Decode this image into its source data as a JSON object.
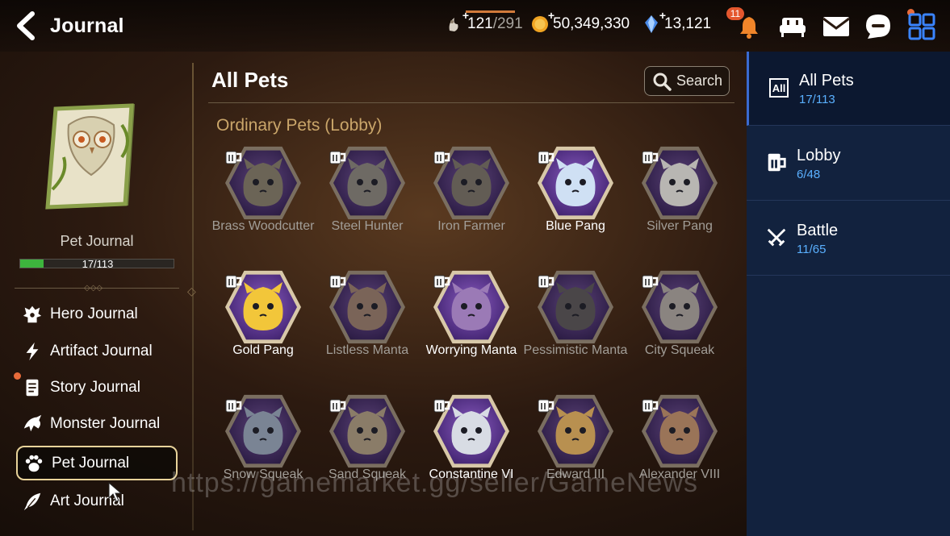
{
  "header": {
    "title": "Journal",
    "stamina": "121",
    "stamina_max": "/291",
    "gold": "50,349,330",
    "crystals": "13,121",
    "notification_count": "11"
  },
  "left_panel": {
    "journal_label": "Pet Journal",
    "progress_text": "17/113",
    "progress_fraction": 0.15,
    "menu": [
      {
        "label": "Hero Journal",
        "icon": "hero-icon"
      },
      {
        "label": "Artifact Journal",
        "icon": "lightning-icon"
      },
      {
        "label": "Story Journal",
        "icon": "scroll-icon"
      },
      {
        "label": "Monster Journal",
        "icon": "dragon-icon"
      },
      {
        "label": "Pet Journal",
        "icon": "paw-icon"
      },
      {
        "label": "Art Journal",
        "icon": "quill-icon"
      }
    ]
  },
  "main": {
    "section_title": "All Pets",
    "search_label": "Search",
    "subsection_title": "Ordinary Pets (Lobby)",
    "pets": [
      {
        "name": "Brass Woodcutter",
        "owned": false,
        "color": "#6b6456"
      },
      {
        "name": "Steel Hunter",
        "owned": false,
        "color": "#6e6a64"
      },
      {
        "name": "Iron Farmer",
        "owned": false,
        "color": "#625c54"
      },
      {
        "name": "Blue Pang",
        "owned": true,
        "color": "#cfe0f4"
      },
      {
        "name": "Silver Pang",
        "owned": false,
        "color": "#b8b6b2"
      },
      {
        "name": "Gold Pang",
        "owned": true,
        "color": "#f2c63a"
      },
      {
        "name": "Listless Manta",
        "owned": false,
        "color": "#7a6458"
      },
      {
        "name": "Worrying Manta",
        "owned": true,
        "color": "#9b7ab6"
      },
      {
        "name": "Pessimistic Manta",
        "owned": false,
        "color": "#4a4648"
      },
      {
        "name": "City Squeak",
        "owned": false,
        "color": "#8a8480"
      },
      {
        "name": "Snow Squeak",
        "owned": false,
        "color": "#7a8494"
      },
      {
        "name": "Sand Squeak",
        "owned": false,
        "color": "#8a7c68"
      },
      {
        "name": "Constantine VI",
        "owned": true,
        "color": "#d8dce4"
      },
      {
        "name": "Edward III",
        "owned": false,
        "color": "#b89050"
      },
      {
        "name": "Alexander VIII",
        "owned": false,
        "color": "#9a7458"
      }
    ]
  },
  "right_panel": {
    "tabs": [
      {
        "label": "All Pets",
        "count": "17/113",
        "icon": "all-icon"
      },
      {
        "label": "Lobby",
        "count": "6/48",
        "icon": "mug-icon"
      },
      {
        "label": "Battle",
        "count": "11/65",
        "icon": "crossed-swords-icon"
      }
    ]
  },
  "watermark": "https://gamemarket.gg/seller/GameNews"
}
